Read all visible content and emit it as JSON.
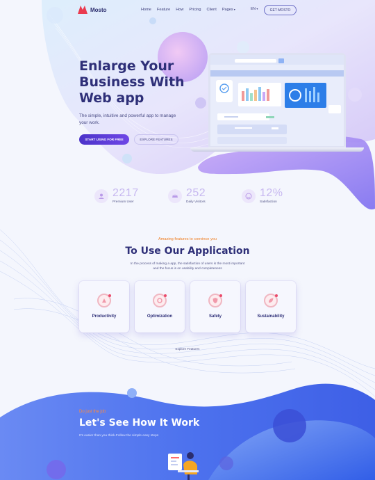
{
  "header": {
    "logo_text": "Mosto",
    "nav": [
      "Home",
      "Feature",
      "How",
      "Pricing",
      "Client",
      "Pages"
    ],
    "lang": "EN",
    "cta": "GET MOSTO"
  },
  "hero": {
    "title_lines": [
      "Enlarge Your",
      "Business With",
      "Web app"
    ],
    "subtitle": "The simple, intuitive and powerful app to manage your work.",
    "btn_primary": "START USING FOR FREE",
    "btn_secondary": "EXPLORE FEATURES"
  },
  "stats": [
    {
      "value": "2217",
      "label": "Premium User",
      "icon": "users-icon"
    },
    {
      "value": "252",
      "label": "Daily Visitors",
      "icon": "crown-icon"
    },
    {
      "value": "12%",
      "label": "Satisfaction",
      "icon": "smile-icon"
    }
  ],
  "features": {
    "eyebrow": "Amazing features to convince you",
    "title": "To Use Our Application",
    "description": "In the process of making a app, the satisfaction of users is the most important and the focus is on usability and completeness",
    "cards": [
      "Productivity",
      "Optimization",
      "Safety",
      "Sustainability"
    ],
    "link": "Explore Features"
  },
  "how": {
    "eyebrow": "Do just the job",
    "title": "Let's See How It Work",
    "subtitle": "It's easier than you think.Follow the simple easy steps"
  },
  "colors": {
    "primary": "#4b33c9",
    "heading": "#2e2f78",
    "accent_orange": "#ef7a1a",
    "background": "#f4f6fd",
    "blue_band": "#4b72ee"
  }
}
